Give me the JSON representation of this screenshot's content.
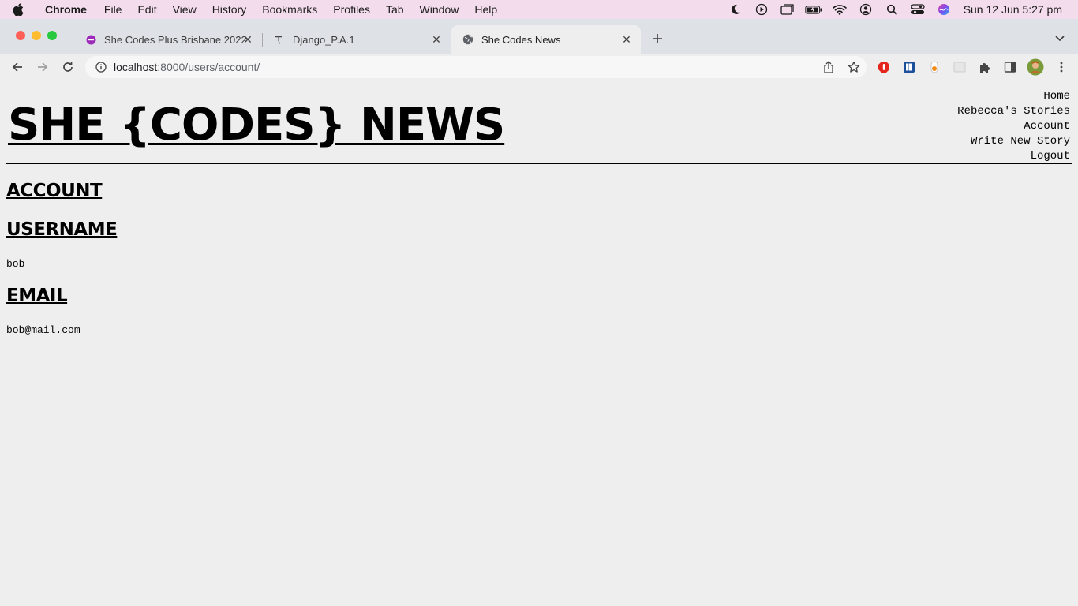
{
  "menubar": {
    "app": "Chrome",
    "items": [
      "File",
      "Edit",
      "View",
      "History",
      "Bookmarks",
      "Profiles",
      "Tab",
      "Window",
      "Help"
    ],
    "clock": "Sun 12 Jun  5:27 pm"
  },
  "tabs": [
    {
      "title": "She Codes Plus Brisbane 2022",
      "favicon": "shecodes-favicon"
    },
    {
      "title": "Django_P.A.1",
      "favicon": "notion-favicon"
    },
    {
      "title": "She Codes News",
      "favicon": "globe-favicon"
    }
  ],
  "address": {
    "host": "localhost",
    "path": ":8000/users/account/"
  },
  "site": {
    "title": "SHE {CODES} NEWS",
    "nav": [
      "Home",
      "Rebecca's Stories",
      "Account",
      "Write New Story",
      "Logout"
    ]
  },
  "account": {
    "heading": "ACCOUNT",
    "username_label": "USERNAME",
    "username": "bob",
    "email_label": "EMAIL",
    "email": "bob@mail.com"
  },
  "colors": {
    "menubar_bg": "#f3dcec",
    "tabstrip_bg": "#dee1e6",
    "page_bg": "#eeeeee",
    "close_red": "#fe5f57",
    "min_yellow": "#febc2e",
    "max_green": "#28c840"
  }
}
